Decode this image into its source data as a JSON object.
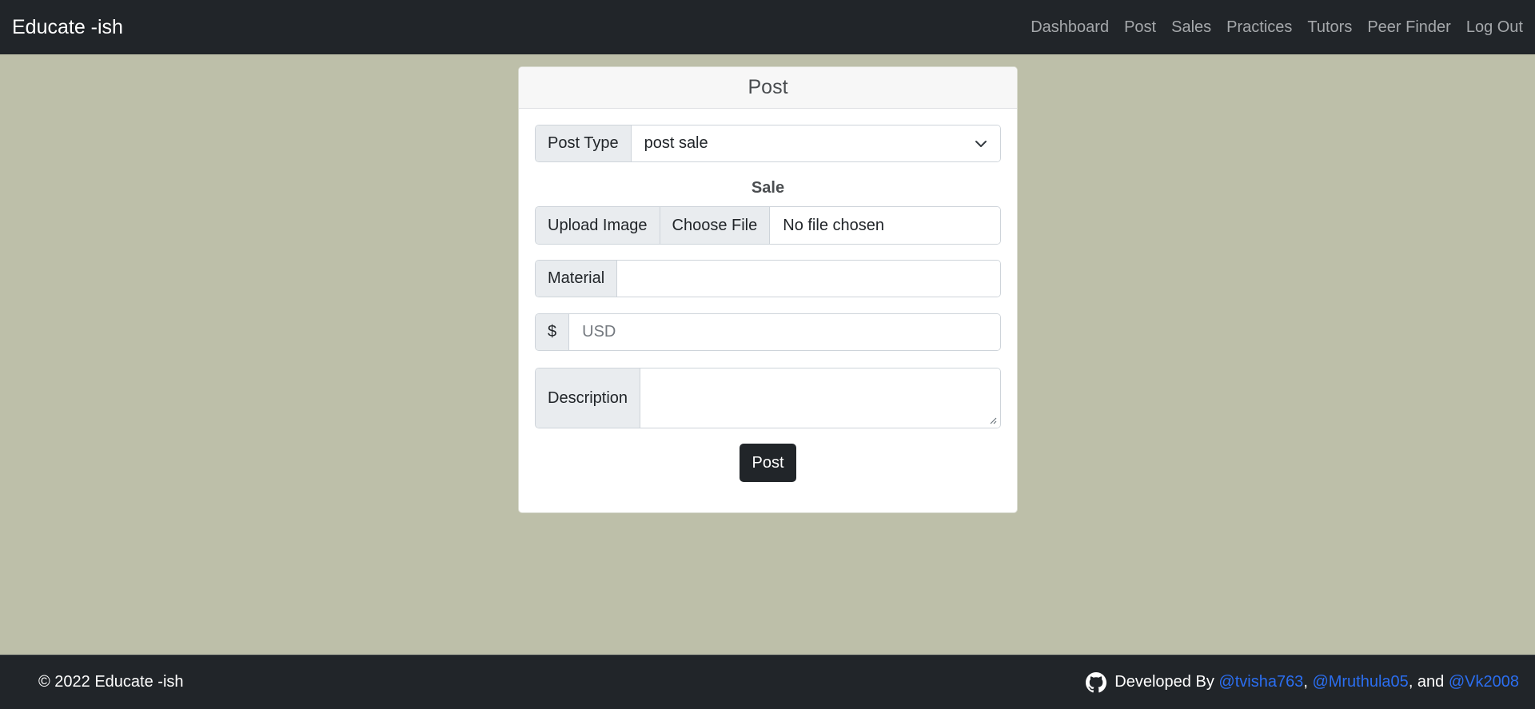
{
  "navbar": {
    "brand": "Educate -ish",
    "links": [
      "Dashboard",
      "Post",
      "Sales",
      "Practices",
      "Tutors",
      "Peer Finder",
      "Log Out"
    ]
  },
  "card": {
    "title": "Post",
    "post_type_label": "Post Type",
    "post_type_value": "post sale",
    "section_label": "Sale",
    "upload_label": "Upload Image",
    "choose_file_label": "Choose File",
    "file_status": "No file chosen",
    "material_label": "Material",
    "material_value": "",
    "price_prefix": "$",
    "price_placeholder": "USD",
    "description_label": "Description",
    "description_value": "",
    "submit_label": "Post"
  },
  "footer": {
    "copyright": "© 2022 Educate -ish",
    "developed_by": "Developed By",
    "dev1": "@tvisha763",
    "sep1": ", ",
    "dev2": "@Mruthula05",
    "sep2": ", and ",
    "dev3": "@Vk2008"
  },
  "colors": {
    "page_background": "#bdbfa9",
    "navbar": "#212529",
    "link_accent": "#2b6ef0"
  },
  "icons": {
    "select": "chevron-down-icon",
    "footer": "github-icon",
    "textarea": "resize-grip-icon"
  }
}
